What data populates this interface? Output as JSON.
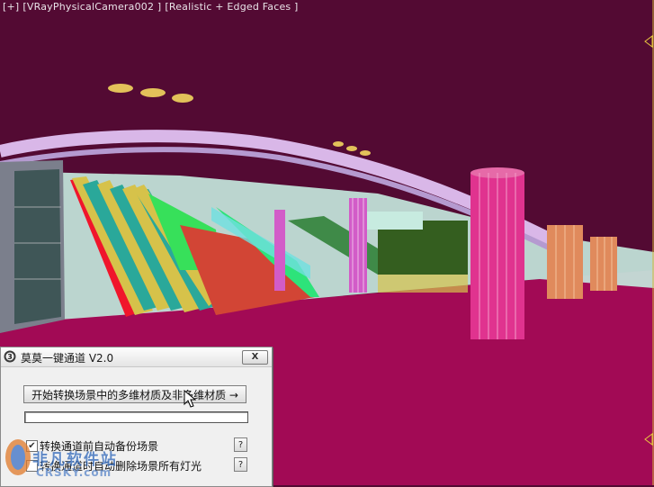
{
  "viewport": {
    "label_parts": [
      "[+]",
      "[VRayPhysicalCamera002 ]",
      "[Realistic + Edged Faces ]"
    ],
    "colors": {
      "ceiling": "#530a33",
      "floor": "#a20a55",
      "column": "#e0338f",
      "escalator_rail": "#d6c24a",
      "escalator_green": "#2de37a",
      "stairs": "#d24535",
      "glass": "#9fd0e0"
    }
  },
  "dialog": {
    "icon": "3dsmax-icon",
    "title": "莫莫一键通道 V2.0",
    "close_label": "X",
    "convert_button_label": "开始转换场景中的多维材质及非多维材质 →",
    "progress_value": 0,
    "options": [
      {
        "label": "转换通道前自动备份场景",
        "checked": true,
        "help_label": "?"
      },
      {
        "label": "转换通道时自动删除场景所有灯光",
        "checked": false,
        "help_label": "?"
      }
    ]
  },
  "watermark": {
    "text": "非凡软件站",
    "subtext": "CRSKY.com"
  }
}
